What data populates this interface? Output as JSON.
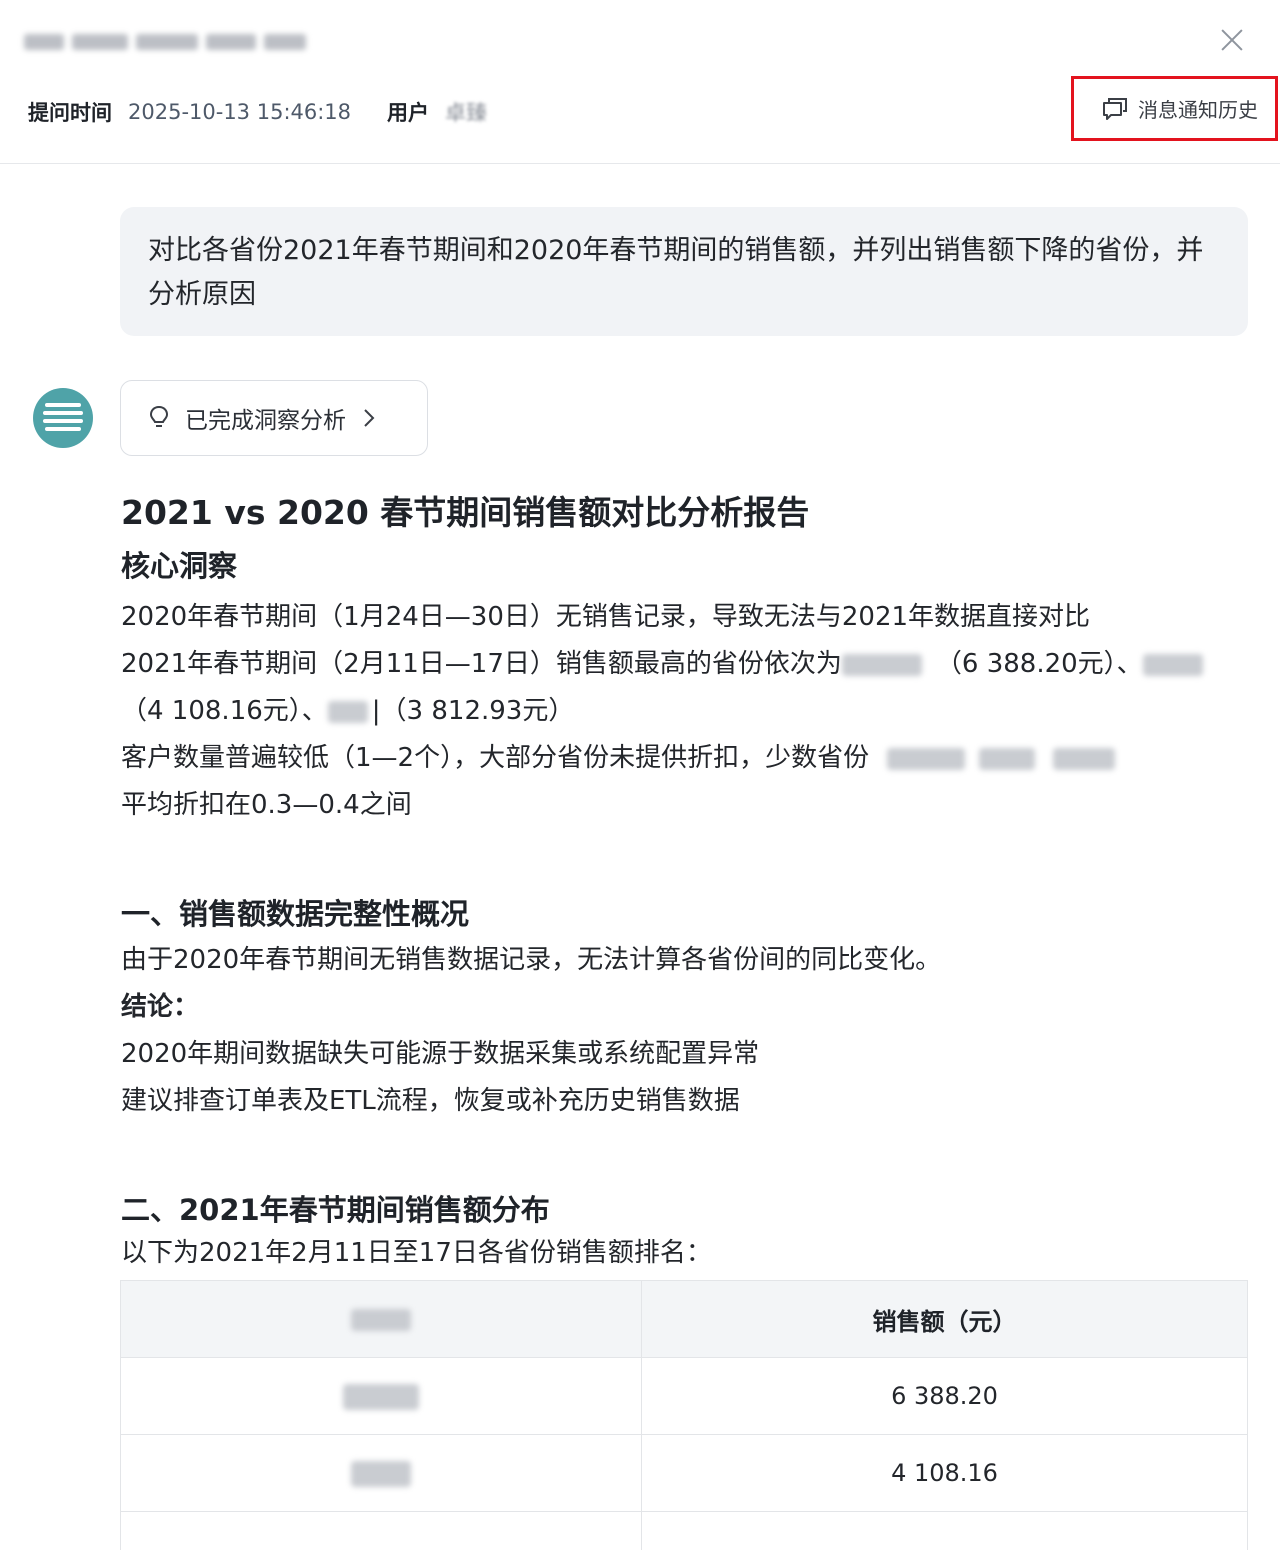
{
  "header": {
    "time_label": "提问时间",
    "time_value": "2025-10-13 15:46:18",
    "user_label": "用户",
    "user_value": "卓臻",
    "history_button_label": "消息通知历史"
  },
  "question": {
    "text": "对比各省份2021年春节期间和2020年春节期间的销售额，并列出销售额下降的省份，并分析原因"
  },
  "insight": {
    "label": "已完成洞察分析"
  },
  "report": {
    "title": "2021 vs 2020 春节期间销售额对比分析报告",
    "core_heading": "核心洞察",
    "core_line1": "2020年春节期间（1月24日—30日）无销售记录，导致无法与2021年数据直接对比",
    "core_line2_a": "2021年春节期间（2月11日—17日）销售额最高的省份依次为",
    "core_line2_b": "（6 388.20元）、",
    "core_line3_a": "（4 108.16元）、",
    "core_line3_b": "|（3 812.93元）",
    "core_line4": "客户数量普遍较低（1—2个），大部分省份未提供折扣，少数省份",
    "core_line5": "平均折扣在0.3—0.4之间",
    "section1_heading": "一、销售额数据完整性概况",
    "section1_text": "由于2020年春节期间无销售数据记录，无法计算各省份间的同比变化。",
    "conclusion_label": "结论：",
    "conclusion_1": "2020年期间数据缺失可能源于数据采集或系统配置异常",
    "conclusion_2": "建议排查订单表及ETL流程，恢复或补充历史销售数据",
    "section2_heading": "二、2021年春节期间销售额分布",
    "section2_intro": "以下为2021年2月11日至17日各省份销售额排名："
  },
  "table": {
    "header_sales": "销售额（元）",
    "rows": [
      {
        "sales": "6 388.20"
      },
      {
        "sales": "4 108.16"
      }
    ]
  }
}
